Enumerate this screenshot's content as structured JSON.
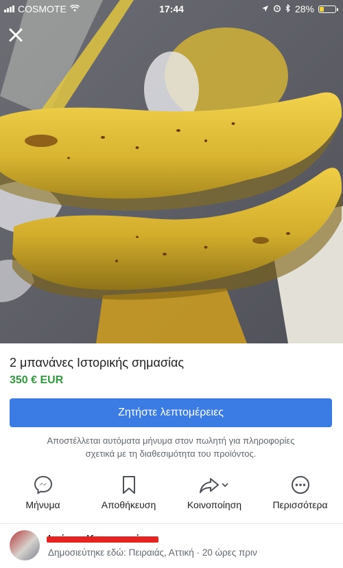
{
  "status_bar": {
    "carrier": "COSMOTE",
    "time": "17:44",
    "battery": "28%",
    "battery_level": 0.28
  },
  "listing": {
    "title": "2 μπανάνες Ιστορικής σημασίας",
    "price": "350 € EUR",
    "cta_label": "Ζητήστε λεπτομέρειες",
    "note_line1": "Αποστέλλεται αυτόματα μήνυμα στον πωλητή για πληροφορίες",
    "note_line2": "σχετικά με τη διαθεσιμότητα του προϊόντος."
  },
  "actions": [
    {
      "label": "Μήνυμα",
      "icon": "messenger-icon"
    },
    {
      "label": "Αποθήκευση",
      "icon": "bookmark-icon"
    },
    {
      "label": "Κοινοποίηση",
      "icon": "share-icon"
    },
    {
      "label": "Περισσότερα",
      "icon": "more-icon"
    }
  ],
  "seller": {
    "name": "Ιωάννα Κωνσταντίνου",
    "location": "Δημοσιεύτηκε εδώ: Πειραιάς, Αττική · 20 ώρες πριν"
  },
  "colors": {
    "primary": "#3b7be4",
    "price": "#2e9a3b",
    "redaction": "#e52320"
  }
}
